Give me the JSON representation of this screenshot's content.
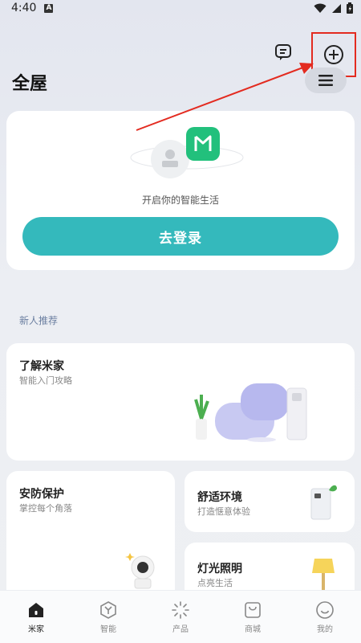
{
  "status_bar": {
    "time": "4:40"
  },
  "header": {
    "title": "全屋"
  },
  "login_card": {
    "tip": "开启你的智能生活",
    "button": "去登录"
  },
  "section": {
    "title": "新人推荐"
  },
  "cards": {
    "learn": {
      "title": "了解米家",
      "subtitle": "智能入门攻略"
    },
    "security": {
      "title": "安防保护",
      "subtitle": "掌控每个角落"
    },
    "environment": {
      "title": "舒适环境",
      "subtitle": "打造惬意体验"
    },
    "lighting": {
      "title": "灯光照明",
      "subtitle": "点亮生活"
    }
  },
  "bottom_nav": {
    "items": [
      {
        "label": "米家",
        "icon": "home-icon",
        "active": true
      },
      {
        "label": "智能",
        "icon": "smart-icon"
      },
      {
        "label": "产品",
        "icon": "product-icon"
      },
      {
        "label": "商城",
        "icon": "store-icon"
      },
      {
        "label": "我的",
        "icon": "profile-icon"
      }
    ]
  },
  "colors": {
    "accent": "#34b9bc",
    "brand_green": "#22c07c",
    "annotation_red": "#e32b20"
  }
}
